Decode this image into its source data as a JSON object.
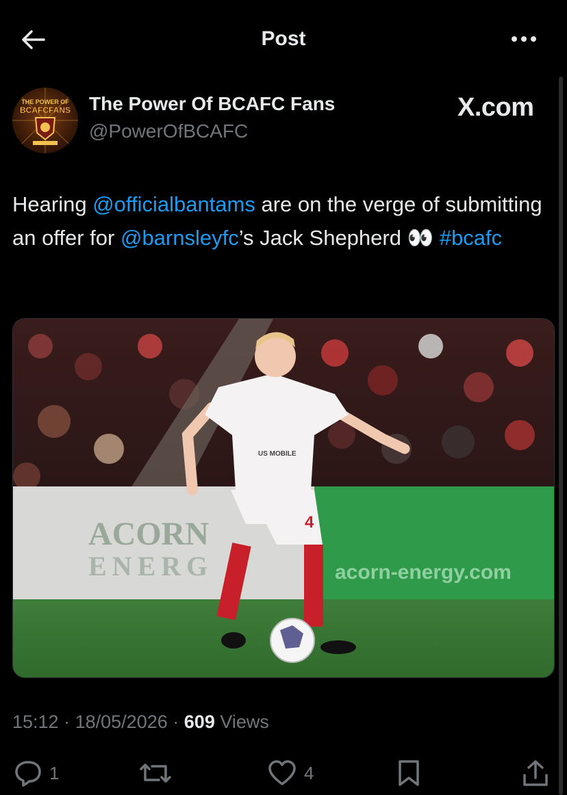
{
  "header": {
    "title": "Post",
    "back_icon": "arrow-left-icon",
    "more_icon": "more-horizontal-icon"
  },
  "author": {
    "name": "The Power Of BCAFC Fans",
    "handle": "@PowerOfBCAFC",
    "avatar_text_top": "THE POWER OF",
    "avatar_text_main": "BCAFCFANS"
  },
  "watermark": "X.com",
  "tweet": {
    "text_1": "Hearing ",
    "mention_1": "@officialbantams",
    "text_2": " are on the verge of submitting an offer for ",
    "mention_2": "@barnsleyfc",
    "text_3": "’s Jack Shepherd ",
    "emoji": "👀",
    "text_4": " ",
    "hashtag": "#bcafc"
  },
  "media": {
    "board_text_1": "ACORN",
    "board_text_2": "ENERG",
    "board_text_3": "acorn-energy.com",
    "sponsor": "US MOBILE",
    "shirt_number": "4"
  },
  "meta": {
    "time": "15:12",
    "separator": "·",
    "date": "18/05/2026",
    "views_count": "609",
    "views_label": "Views"
  },
  "actions": {
    "reply_count": "1",
    "retweet_count": "",
    "like_count": "4"
  },
  "colors": {
    "background": "#000000",
    "text": "#e7e9ea",
    "secondary": "#71767b",
    "link": "#1d9bf0"
  }
}
